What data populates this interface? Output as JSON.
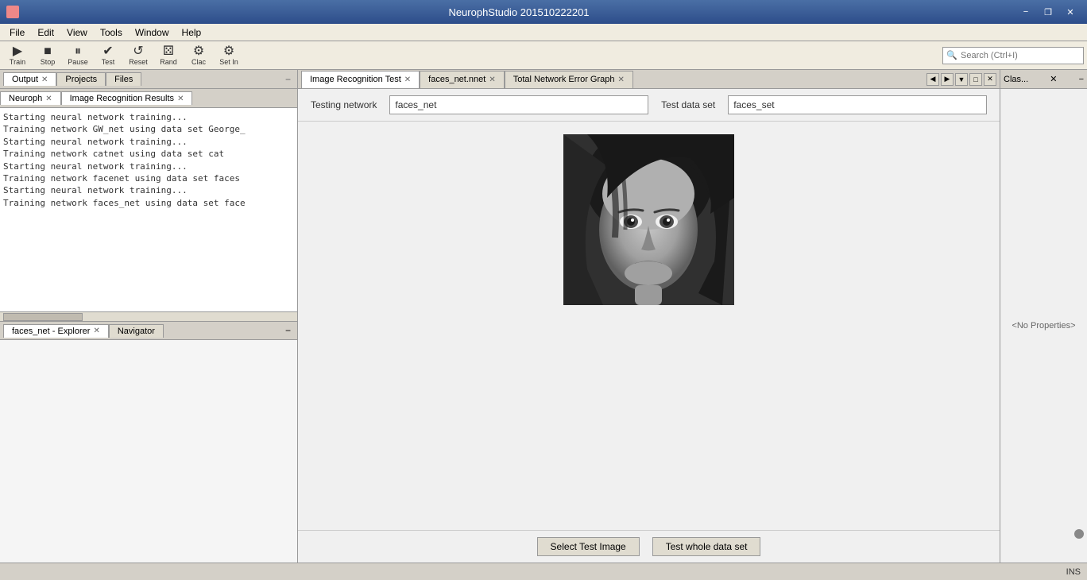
{
  "titlebar": {
    "title": "NeurophStudio 201510222201",
    "minimize_label": "−",
    "restore_label": "❐",
    "close_label": "✕"
  },
  "menubar": {
    "items": [
      "File",
      "Edit",
      "View",
      "Tools",
      "Window",
      "Help"
    ]
  },
  "toolbar": {
    "buttons": [
      {
        "id": "train",
        "label": "Train",
        "icon": "▶"
      },
      {
        "id": "stop",
        "label": "Stop",
        "icon": "■"
      },
      {
        "id": "pause",
        "label": "Pause",
        "icon": "⏸"
      },
      {
        "id": "test",
        "label": "Test",
        "icon": "✔"
      },
      {
        "id": "reset",
        "label": "Reset",
        "icon": "↺"
      },
      {
        "id": "rand",
        "label": "Rand",
        "icon": "🎲"
      },
      {
        "id": "clac",
        "label": "Clac",
        "icon": "⚙"
      },
      {
        "id": "set",
        "label": "Set In",
        "icon": "⚙"
      }
    ],
    "search_placeholder": "Search (Ctrl+I)"
  },
  "left_panel": {
    "top_tabs": [
      {
        "label": "Output",
        "closable": true,
        "active": true
      },
      {
        "label": "Projects",
        "active": false
      },
      {
        "label": "Files",
        "active": false
      }
    ],
    "neuroph_tabs": [
      {
        "label": "Neuroph",
        "closable": true,
        "active": true
      },
      {
        "label": "Image Recognition Results",
        "closable": true,
        "active": true
      }
    ],
    "console_lines": [
      "Starting neural network training...",
      "Training network GW_net using data set George_",
      "Starting neural network training...",
      "Training network catnet using data set cat",
      "Starting neural network training...",
      "Training network facenet using data set faces",
      "Starting neural network training...",
      "Training network faces_net using data set face"
    ],
    "bottom_tabs": [
      {
        "label": "faces_net - Explorer",
        "closable": true,
        "active": true
      },
      {
        "label": "Navigator",
        "active": false
      }
    ]
  },
  "center_panel": {
    "tabs": [
      {
        "label": "Image Recognition Test",
        "closable": true,
        "active": true
      },
      {
        "label": "faces_net.nnet",
        "closable": true,
        "active": false
      },
      {
        "label": "Total Network Error Graph",
        "closable": true,
        "active": false
      }
    ],
    "testing_network_label": "Testing network",
    "testing_network_value": "faces_net",
    "test_data_set_label": "Test data set",
    "test_data_set_value": "faces_set",
    "select_test_image_btn": "Select Test Image",
    "test_whole_dataset_btn": "Test whole data set"
  },
  "right_panel": {
    "title": "Clas...",
    "closable": true,
    "no_properties": "<No Properties>"
  },
  "statusbar": {
    "text": "INS"
  }
}
